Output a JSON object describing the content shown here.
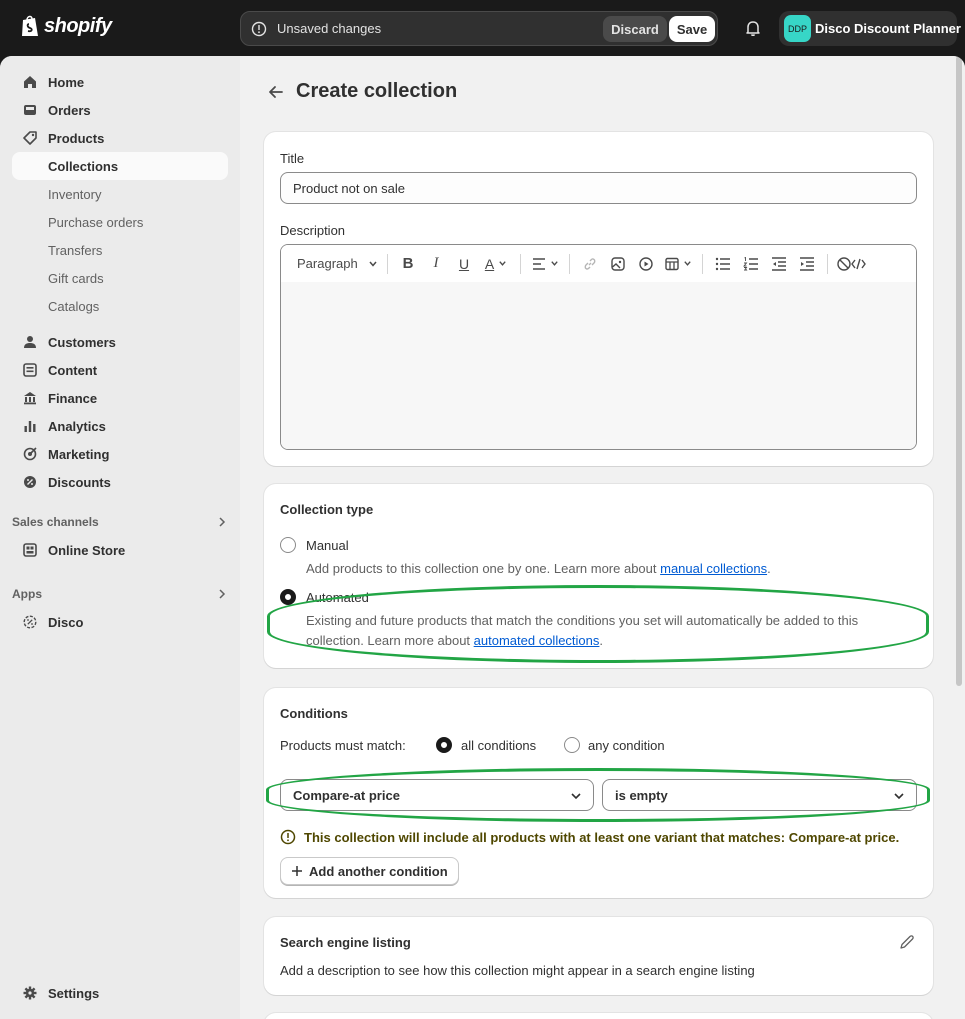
{
  "topbar": {
    "brand": "shopify",
    "unsaved_text": "Unsaved changes",
    "discard_label": "Discard",
    "save_label": "Save",
    "store_initials": "DDP",
    "store_name": "Disco Discount Planner"
  },
  "sidebar": {
    "items": [
      {
        "label": "Home",
        "icon": "home-icon"
      },
      {
        "label": "Orders",
        "icon": "inbox-icon"
      },
      {
        "label": "Products",
        "icon": "tag-icon"
      },
      {
        "label": "Collections"
      },
      {
        "label": "Inventory"
      },
      {
        "label": "Purchase orders"
      },
      {
        "label": "Transfers"
      },
      {
        "label": "Gift cards"
      },
      {
        "label": "Catalogs"
      },
      {
        "label": "Customers",
        "icon": "person-icon"
      },
      {
        "label": "Content",
        "icon": "content-icon"
      },
      {
        "label": "Finance",
        "icon": "bank-icon"
      },
      {
        "label": "Analytics",
        "icon": "bar-chart-icon"
      },
      {
        "label": "Marketing",
        "icon": "target-icon"
      },
      {
        "label": "Discounts",
        "icon": "discount-icon"
      }
    ],
    "sales_channels_label": "Sales channels",
    "online_store_label": "Online Store",
    "apps_label": "Apps",
    "disco_label": "Disco",
    "settings_label": "Settings"
  },
  "page": {
    "title": "Create collection"
  },
  "details": {
    "title_label": "Title",
    "title_value": "Product not on sale",
    "description_label": "Description",
    "paragraph_label": "Paragraph"
  },
  "collection_type": {
    "heading": "Collection type",
    "manual_label": "Manual",
    "manual_help": "Add products to this collection one by one. Learn more about ",
    "manual_link": "manual collections",
    "automated_label": "Automated",
    "automated_help": "Existing and future products that match the conditions you set will automatically be added to this collection. Learn more about ",
    "automated_link": "automated collections",
    "selected": "Automated"
  },
  "conditions": {
    "heading": "Conditions",
    "match_label": "Products must match:",
    "all_label": "all conditions",
    "any_label": "any condition",
    "field_value": "Compare-at price",
    "operator_value": "is empty",
    "warning": "This collection will include all products with at least one variant that matches: Compare-at price.",
    "add_label": "Add another condition"
  },
  "seo": {
    "heading": "Search engine listing",
    "help": "Add a description to see how this collection might appear in a search engine listing"
  },
  "colors": {
    "topbar": "#1a1a1a",
    "accent_link": "#005bd3",
    "highlight_oval": "#22a545",
    "store_avatar": "#37d6c7",
    "warning_text": "#4f4700"
  }
}
